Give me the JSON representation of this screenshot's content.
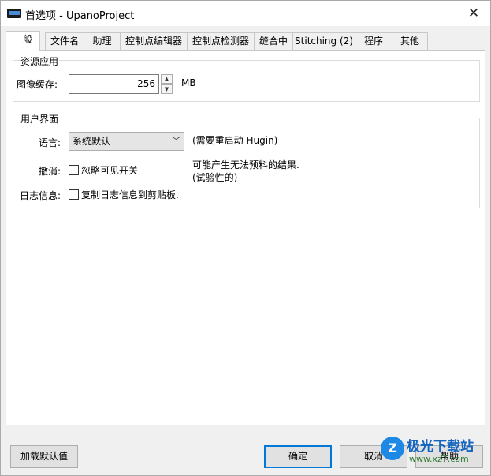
{
  "window": {
    "title": "首选项 - UpanoProject",
    "icon": "hugin-app-icon",
    "close_glyph": "✕"
  },
  "tabs": [
    {
      "label": "一般",
      "active": true
    },
    {
      "label": "文件名"
    },
    {
      "label": "助理"
    },
    {
      "label": "控制点编辑器"
    },
    {
      "label": "控制点检测器"
    },
    {
      "label": "缝合中"
    },
    {
      "label": "Stitching (2)"
    },
    {
      "label": "程序"
    },
    {
      "label": "其他"
    }
  ],
  "resources": {
    "group_title": "资源应用",
    "cache_label": "图像缓存:",
    "cache_value": "256",
    "cache_unit": "MB",
    "spin_up_glyph": "▲",
    "spin_down_glyph": "▼"
  },
  "ui": {
    "group_title": "用户界面",
    "language_label": "语言:",
    "language_value": "系统默认",
    "dropdown_glyph": "﹀",
    "restart_note": "(需要重启动 Hugin)",
    "undo_label": "撤消:",
    "undo_checkbox_label": "忽略可见开关",
    "undo_checked": false,
    "undo_warning_line1": "可能产生无法预料的结果.",
    "undo_warning_line2": "(试验性的)",
    "log_label": "日志信息:",
    "log_checkbox_label": "复制日志信息到剪贴板.",
    "log_checked": false
  },
  "buttons": {
    "load_defaults": "加载默认值",
    "ok": "确定",
    "cancel": "取消",
    "help": "帮助"
  },
  "watermark": {
    "name": "极光下载站",
    "url": "www.xz7.com",
    "logo_glyph": "Z"
  },
  "colors": {
    "focus_border": "#0078d7",
    "window_bg": "#f0f0f0",
    "panel_bg": "#ffffff"
  }
}
